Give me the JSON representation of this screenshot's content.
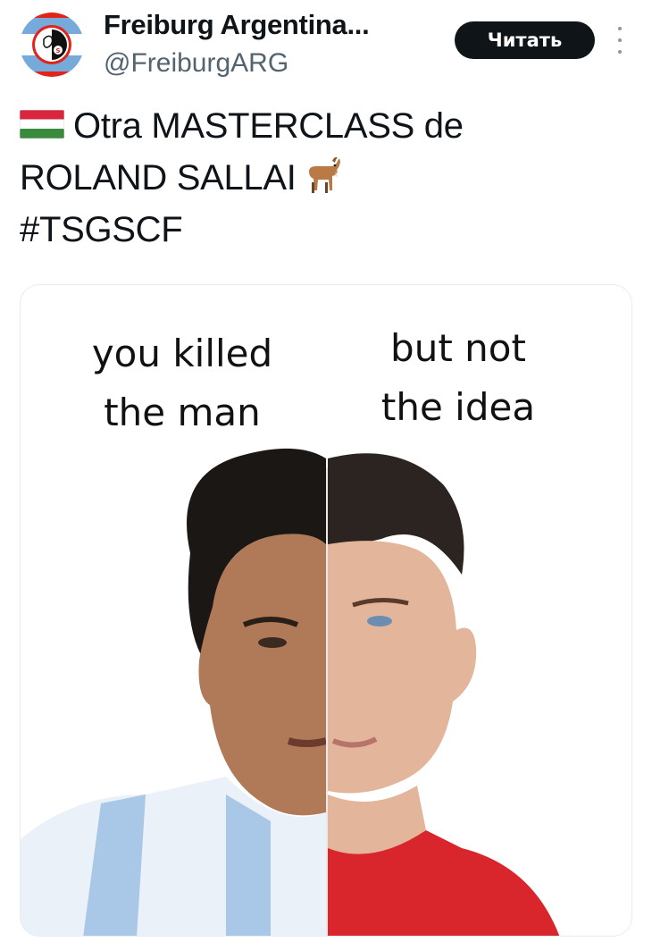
{
  "account": {
    "display_name": "Freiburg Argentina...",
    "handle": "@FreiburgARG",
    "follow_label": "Читать"
  },
  "tweet": {
    "line1": "Otra MASTERCLASS de",
    "line2": "ROLAND SALLAI",
    "line3": "#TSGSCF",
    "flag_icon": "hungary-flag-icon",
    "goat_icon": "goat-emoji-icon"
  },
  "media": {
    "left_caption": [
      "you killed",
      "the man"
    ],
    "right_caption": [
      "but not",
      "the idea"
    ]
  },
  "colors": {
    "text": "#0f1419",
    "secondary": "#536471",
    "button_bg": "#0f1419",
    "avatar_blue": "#6fa8dc",
    "avatar_red": "#e2231a"
  }
}
